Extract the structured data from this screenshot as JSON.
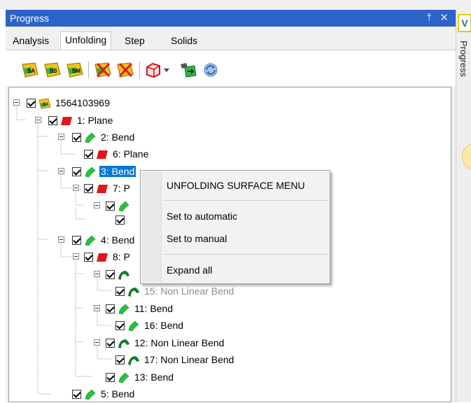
{
  "panel": {
    "title": "Progress",
    "pin_glyph": "†",
    "close_glyph": "✕"
  },
  "sidebar": {
    "button_letter": "V",
    "label": "Progress"
  },
  "tabs": [
    {
      "label": "Analysis",
      "active": false
    },
    {
      "label": "Unfolding",
      "active": true
    },
    {
      "label": "Step",
      "active": false
    },
    {
      "label": "Solids",
      "active": false
    }
  ],
  "toolbar": [
    "unfold-sa-icon",
    "unfold-ss-icon",
    "unfold-sm-icon",
    "clear-unfold-icon",
    "remove-unfold-icon",
    "solid-view-icon",
    "dropdown-arrow-icon",
    "export-icon",
    "refresh-icon"
  ],
  "tree": {
    "root": "1564103969",
    "nodes": [
      {
        "id": "n1",
        "label": "1: Plane",
        "icon": "plane"
      },
      {
        "id": "n2",
        "label": "2: Bend",
        "icon": "bend"
      },
      {
        "id": "n6",
        "label": "6: Plane",
        "icon": "plane"
      },
      {
        "id": "n3",
        "label": "3: Bend",
        "icon": "bend",
        "selected": true
      },
      {
        "id": "n7",
        "label": "7: P",
        "icon": "plane"
      },
      {
        "id": "n7c",
        "label": "",
        "icon": "bend"
      },
      {
        "id": "n7cc",
        "label": "",
        "icon": "none"
      },
      {
        "id": "n4",
        "label": "4: Bend",
        "icon": "bend"
      },
      {
        "id": "n8",
        "label": "8: P",
        "icon": "plane"
      },
      {
        "id": "n8c",
        "label": "",
        "icon": "nonlinear"
      },
      {
        "id": "n15",
        "label": "15: Non Linear Bend",
        "icon": "nonlinear",
        "dim": true
      },
      {
        "id": "n11",
        "label": "11: Bend",
        "icon": "bend"
      },
      {
        "id": "n16",
        "label": "16: Bend",
        "icon": "bend"
      },
      {
        "id": "n12",
        "label": "12: Non Linear Bend",
        "icon": "nonlinear"
      },
      {
        "id": "n17",
        "label": "17: Non Linear Bend",
        "icon": "nonlinear"
      },
      {
        "id": "n13",
        "label": "13: Bend",
        "icon": "bend"
      },
      {
        "id": "n5",
        "label": "5: Bend",
        "icon": "bend"
      }
    ]
  },
  "context_menu": {
    "header": "UNFOLDING SURFACE MENU",
    "items": [
      "Set to automatic",
      "Set to manual",
      "Expand all"
    ]
  },
  "colors": {
    "titlebar": "#2d63c8",
    "selection": "#0078d7",
    "plane": "#e0161b",
    "bend": "#27c43a",
    "nonlinear": "#1a7a2c"
  }
}
